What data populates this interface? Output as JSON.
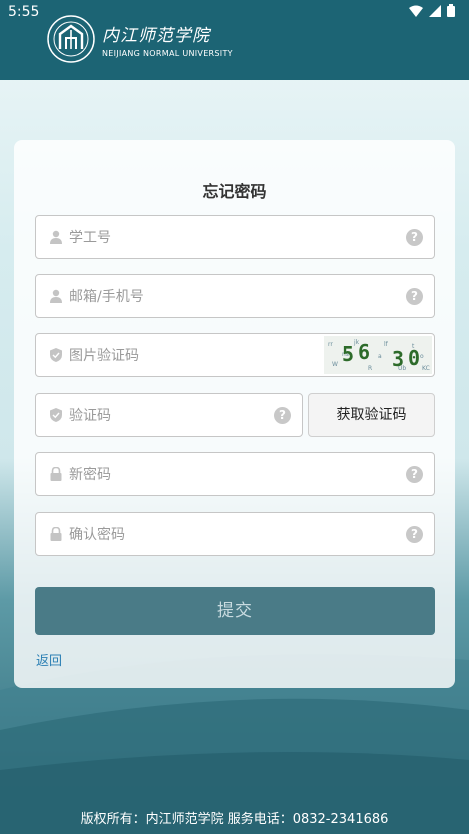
{
  "status": {
    "time": "5:55",
    "icons": [
      "wifi-icon",
      "signal-icon",
      "battery-icon"
    ]
  },
  "header": {
    "logo_cn": "内江师范学院",
    "logo_en": "NEIJIANG NORMAL UNIVERSITY",
    "bg_color": "#1c6474"
  },
  "form": {
    "title": "忘记密码",
    "fields": {
      "student_id": {
        "placeholder": "学工号",
        "icon": "user-icon"
      },
      "email_phone": {
        "placeholder": "邮箱/手机号",
        "icon": "user-icon"
      },
      "image_captcha": {
        "placeholder": "图片验证码",
        "icon": "shield-icon",
        "captcha_text": "5630"
      },
      "verify_code": {
        "placeholder": "验证码",
        "icon": "shield-icon"
      },
      "new_password": {
        "placeholder": "新密码",
        "icon": "lock-icon"
      },
      "confirm_password": {
        "placeholder": "确认密码",
        "icon": "lock-icon"
      }
    },
    "get_code_label": "获取验证码",
    "submit_label": "提交",
    "back_label": "返回",
    "accent_color": "#4a7b87",
    "link_color": "#2b7fb4"
  },
  "footer": {
    "text": "版权所有：内江师范学院 服务电话：0832-2341686"
  }
}
